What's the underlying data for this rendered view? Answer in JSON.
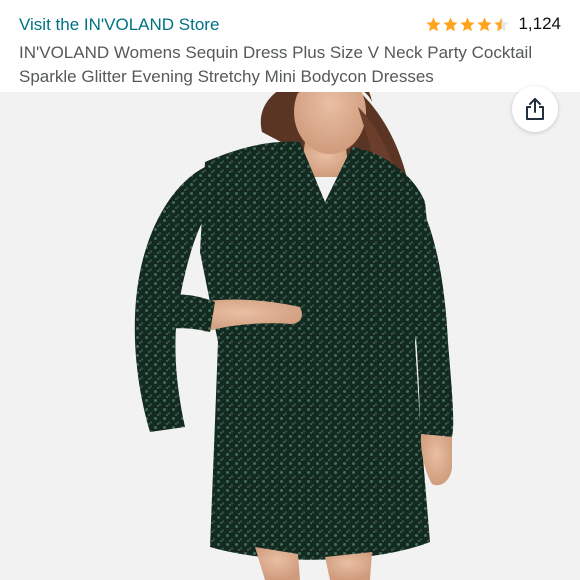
{
  "store_link": "Visit the IN'VOLAND Store",
  "rating": {
    "stars": 4.5,
    "review_count": "1,124",
    "star_color": "#FFA41C"
  },
  "product": {
    "title": "IN'VOLAND Womens Sequin Dress Plus Size V Neck Party Cocktail Sparkle Glitter Evening Stretchy Mini Bodycon Dresses",
    "image_alt": "Model wearing dark green sequin long-sleeve V-neck mini dress",
    "dress_color": "#1c3a2c"
  },
  "share_icon": "share-icon",
  "colors": {
    "link": "#007185",
    "title": "#565959",
    "background": "#f2f2f2"
  }
}
